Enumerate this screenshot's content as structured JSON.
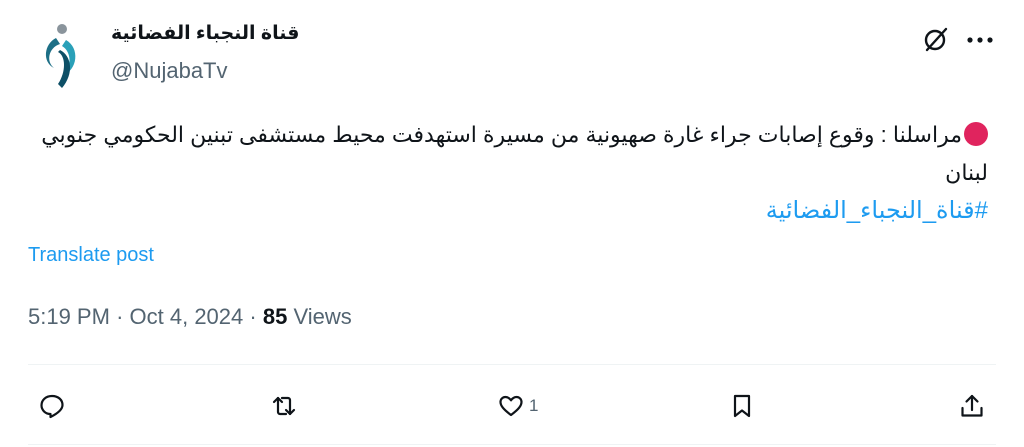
{
  "account": {
    "display_name": "قناة النجباء الفضائية",
    "handle": "@NujabaTv"
  },
  "post": {
    "text": "مراسلنا : وقوع إصابات جراء غارة صهيونية من مسيرة استهدفت محيط مستشفى تبنين الحكومي جنوبي لبنان",
    "hashtag": "#قناة_النجباء_الفضائية",
    "translate_label": "Translate post",
    "time": "5:19 PM",
    "date": "Oct 4, 2024",
    "separator": "·",
    "views_count": "85",
    "views_label": "Views"
  },
  "actions": {
    "like_count": "1"
  },
  "colors": {
    "accent": "#1d9bf0",
    "secondary_text": "#536471",
    "red_dot": "#e0245e"
  },
  "icons": [
    "grok-icon",
    "more-icon",
    "reply-icon",
    "repost-icon",
    "like-icon",
    "bookmark-icon",
    "share-icon",
    "red-circle-emoji"
  ]
}
